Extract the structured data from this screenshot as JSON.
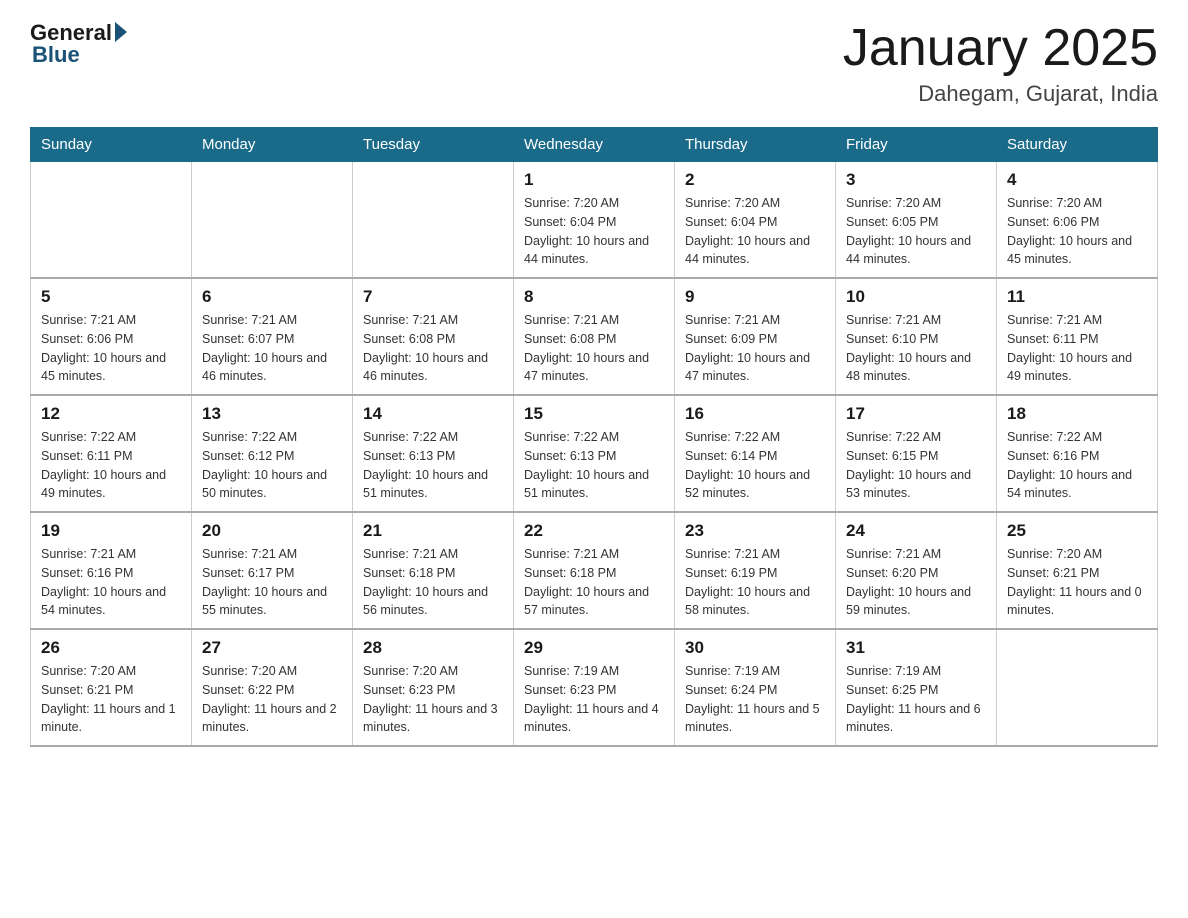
{
  "header": {
    "logo_general": "General",
    "logo_blue": "Blue",
    "title": "January 2025",
    "subtitle": "Dahegam, Gujarat, India"
  },
  "days_of_week": [
    "Sunday",
    "Monday",
    "Tuesday",
    "Wednesday",
    "Thursday",
    "Friday",
    "Saturday"
  ],
  "weeks": [
    [
      {
        "day": "",
        "info": ""
      },
      {
        "day": "",
        "info": ""
      },
      {
        "day": "",
        "info": ""
      },
      {
        "day": "1",
        "info": "Sunrise: 7:20 AM\nSunset: 6:04 PM\nDaylight: 10 hours\nand 44 minutes."
      },
      {
        "day": "2",
        "info": "Sunrise: 7:20 AM\nSunset: 6:04 PM\nDaylight: 10 hours\nand 44 minutes."
      },
      {
        "day": "3",
        "info": "Sunrise: 7:20 AM\nSunset: 6:05 PM\nDaylight: 10 hours\nand 44 minutes."
      },
      {
        "day": "4",
        "info": "Sunrise: 7:20 AM\nSunset: 6:06 PM\nDaylight: 10 hours\nand 45 minutes."
      }
    ],
    [
      {
        "day": "5",
        "info": "Sunrise: 7:21 AM\nSunset: 6:06 PM\nDaylight: 10 hours\nand 45 minutes."
      },
      {
        "day": "6",
        "info": "Sunrise: 7:21 AM\nSunset: 6:07 PM\nDaylight: 10 hours\nand 46 minutes."
      },
      {
        "day": "7",
        "info": "Sunrise: 7:21 AM\nSunset: 6:08 PM\nDaylight: 10 hours\nand 46 minutes."
      },
      {
        "day": "8",
        "info": "Sunrise: 7:21 AM\nSunset: 6:08 PM\nDaylight: 10 hours\nand 47 minutes."
      },
      {
        "day": "9",
        "info": "Sunrise: 7:21 AM\nSunset: 6:09 PM\nDaylight: 10 hours\nand 47 minutes."
      },
      {
        "day": "10",
        "info": "Sunrise: 7:21 AM\nSunset: 6:10 PM\nDaylight: 10 hours\nand 48 minutes."
      },
      {
        "day": "11",
        "info": "Sunrise: 7:21 AM\nSunset: 6:11 PM\nDaylight: 10 hours\nand 49 minutes."
      }
    ],
    [
      {
        "day": "12",
        "info": "Sunrise: 7:22 AM\nSunset: 6:11 PM\nDaylight: 10 hours\nand 49 minutes."
      },
      {
        "day": "13",
        "info": "Sunrise: 7:22 AM\nSunset: 6:12 PM\nDaylight: 10 hours\nand 50 minutes."
      },
      {
        "day": "14",
        "info": "Sunrise: 7:22 AM\nSunset: 6:13 PM\nDaylight: 10 hours\nand 51 minutes."
      },
      {
        "day": "15",
        "info": "Sunrise: 7:22 AM\nSunset: 6:13 PM\nDaylight: 10 hours\nand 51 minutes."
      },
      {
        "day": "16",
        "info": "Sunrise: 7:22 AM\nSunset: 6:14 PM\nDaylight: 10 hours\nand 52 minutes."
      },
      {
        "day": "17",
        "info": "Sunrise: 7:22 AM\nSunset: 6:15 PM\nDaylight: 10 hours\nand 53 minutes."
      },
      {
        "day": "18",
        "info": "Sunrise: 7:22 AM\nSunset: 6:16 PM\nDaylight: 10 hours\nand 54 minutes."
      }
    ],
    [
      {
        "day": "19",
        "info": "Sunrise: 7:21 AM\nSunset: 6:16 PM\nDaylight: 10 hours\nand 54 minutes."
      },
      {
        "day": "20",
        "info": "Sunrise: 7:21 AM\nSunset: 6:17 PM\nDaylight: 10 hours\nand 55 minutes."
      },
      {
        "day": "21",
        "info": "Sunrise: 7:21 AM\nSunset: 6:18 PM\nDaylight: 10 hours\nand 56 minutes."
      },
      {
        "day": "22",
        "info": "Sunrise: 7:21 AM\nSunset: 6:18 PM\nDaylight: 10 hours\nand 57 minutes."
      },
      {
        "day": "23",
        "info": "Sunrise: 7:21 AM\nSunset: 6:19 PM\nDaylight: 10 hours\nand 58 minutes."
      },
      {
        "day": "24",
        "info": "Sunrise: 7:21 AM\nSunset: 6:20 PM\nDaylight: 10 hours\nand 59 minutes."
      },
      {
        "day": "25",
        "info": "Sunrise: 7:20 AM\nSunset: 6:21 PM\nDaylight: 11 hours\nand 0 minutes."
      }
    ],
    [
      {
        "day": "26",
        "info": "Sunrise: 7:20 AM\nSunset: 6:21 PM\nDaylight: 11 hours\nand 1 minute."
      },
      {
        "day": "27",
        "info": "Sunrise: 7:20 AM\nSunset: 6:22 PM\nDaylight: 11 hours\nand 2 minutes."
      },
      {
        "day": "28",
        "info": "Sunrise: 7:20 AM\nSunset: 6:23 PM\nDaylight: 11 hours\nand 3 minutes."
      },
      {
        "day": "29",
        "info": "Sunrise: 7:19 AM\nSunset: 6:23 PM\nDaylight: 11 hours\nand 4 minutes."
      },
      {
        "day": "30",
        "info": "Sunrise: 7:19 AM\nSunset: 6:24 PM\nDaylight: 11 hours\nand 5 minutes."
      },
      {
        "day": "31",
        "info": "Sunrise: 7:19 AM\nSunset: 6:25 PM\nDaylight: 11 hours\nand 6 minutes."
      },
      {
        "day": "",
        "info": ""
      }
    ]
  ]
}
